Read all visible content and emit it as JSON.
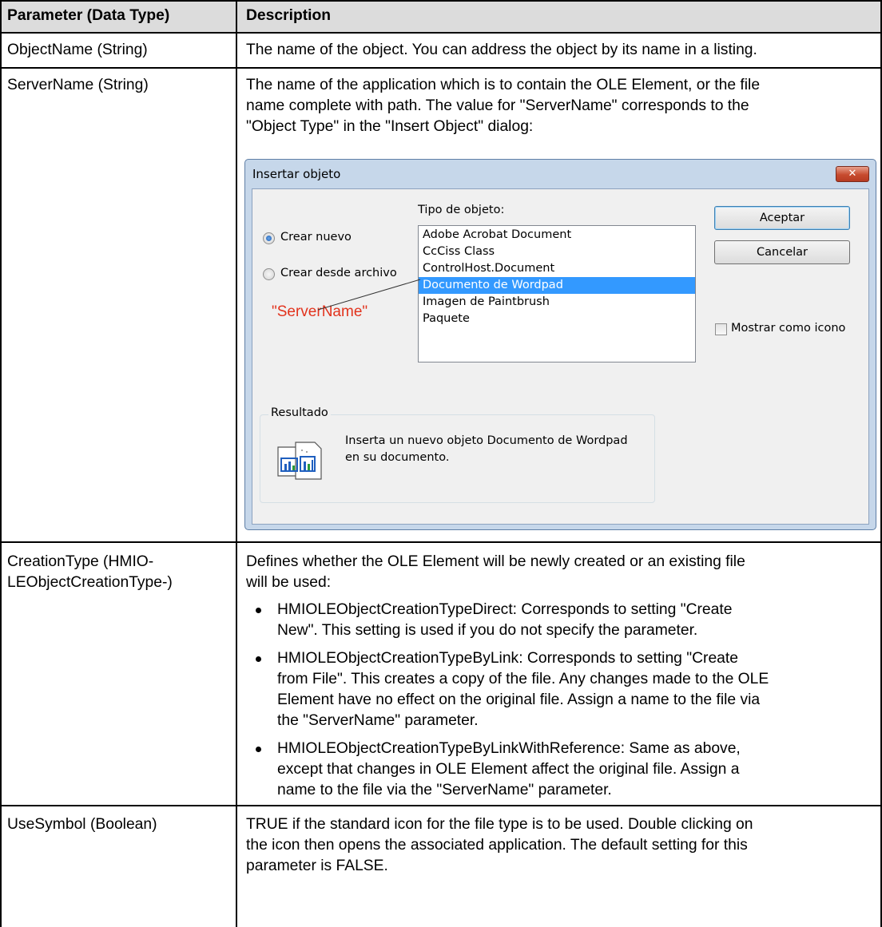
{
  "table": {
    "header": {
      "col1": "Parameter (Data Type)",
      "col2": "Description"
    },
    "rows": [
      {
        "param": "ObjectName (String)",
        "desc": "The name of the object. You can address the object by its name in a listing."
      },
      {
        "param": "ServerName (String)",
        "desc_lines": [
          "The name of the application which is to contain the OLE Element, or the file",
          "name complete with path. The value for \"ServerName\" corresponds to the",
          "\"Object Type\" in the \"Insert Object\" dialog:"
        ]
      },
      {
        "param_lines": [
          "CreationType (HMIO-",
          "LEObjectCreationType-)"
        ],
        "desc_lines": [
          "Defines whether the OLE Element will be newly created or an existing file",
          "will be used:"
        ],
        "bullets": [
          [
            "HMIOLEObjectCreationTypeDirect: Corresponds to setting \"Create",
            "New\". This setting is used if you do not specify the parameter."
          ],
          [
            "HMIOLEObjectCreationTypeByLink: Corresponds to setting \"Create",
            "from File\". This creates a copy of the file. Any changes made to the OLE",
            "Element have no effect on the original file. Assign a name to the file via",
            "the \"ServerName\" parameter."
          ],
          [
            "HMIOLEObjectCreationTypeByLinkWithReference: Same as above,",
            "except that changes in OLE Element affect the original file. Assign a",
            "name to the file via the \"ServerName\" parameter."
          ]
        ]
      },
      {
        "param": "UseSymbol (Boolean)",
        "desc_lines": [
          "TRUE if the standard icon for the file type is to be used. Double clicking on",
          "the icon then opens the associated application. The default setting for this",
          "parameter is FALSE."
        ]
      }
    ]
  },
  "dialog": {
    "title": "Insertar objeto",
    "close_glyph": "✕",
    "radio_new": "Crear nuevo",
    "radio_file": "Crear desde archivo",
    "object_type_label": "Tipo de objeto:",
    "object_types": [
      "Adobe Acrobat Document",
      "CcCiss Class",
      "ControlHost.Document",
      "Documento de Wordpad",
      "Imagen de Paintbrush",
      "Paquete"
    ],
    "selected_index": 3,
    "ok_label": "Aceptar",
    "cancel_label": "Cancelar",
    "show_as_icon_label": "Mostrar como icono",
    "result_group_label": "Resultado",
    "result_lines": [
      "Inserta un nuevo objeto Documento de Wordpad",
      "en su documento."
    ],
    "annotation": "\"ServerName\"",
    "colors": {
      "annotation": "#e2331d",
      "selection": "#3399ff",
      "header_bg": "#dcdcdc"
    }
  }
}
